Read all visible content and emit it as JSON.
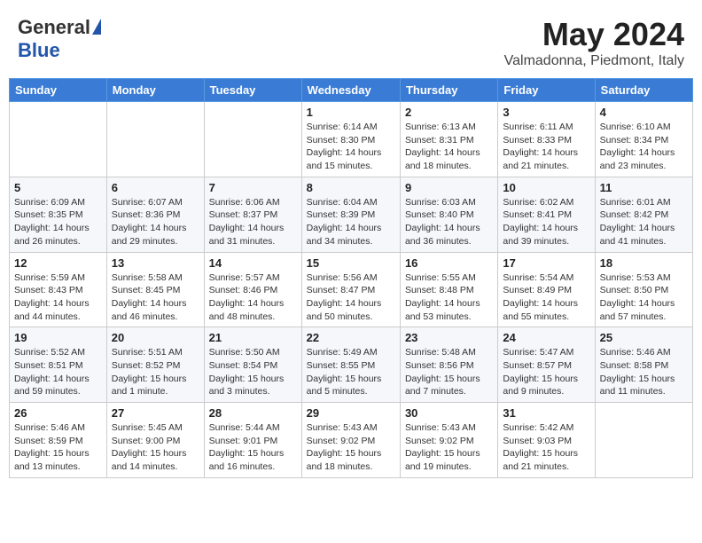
{
  "header": {
    "logo_general": "General",
    "logo_blue": "Blue",
    "main_title": "May 2024",
    "sub_title": "Valmadonna, Piedmont, Italy"
  },
  "days_of_week": [
    "Sunday",
    "Monday",
    "Tuesday",
    "Wednesday",
    "Thursday",
    "Friday",
    "Saturday"
  ],
  "weeks": [
    [
      {
        "day": "",
        "info": ""
      },
      {
        "day": "",
        "info": ""
      },
      {
        "day": "",
        "info": ""
      },
      {
        "day": "1",
        "info": "Sunrise: 6:14 AM\nSunset: 8:30 PM\nDaylight: 14 hours\nand 15 minutes."
      },
      {
        "day": "2",
        "info": "Sunrise: 6:13 AM\nSunset: 8:31 PM\nDaylight: 14 hours\nand 18 minutes."
      },
      {
        "day": "3",
        "info": "Sunrise: 6:11 AM\nSunset: 8:33 PM\nDaylight: 14 hours\nand 21 minutes."
      },
      {
        "day": "4",
        "info": "Sunrise: 6:10 AM\nSunset: 8:34 PM\nDaylight: 14 hours\nand 23 minutes."
      }
    ],
    [
      {
        "day": "5",
        "info": "Sunrise: 6:09 AM\nSunset: 8:35 PM\nDaylight: 14 hours\nand 26 minutes."
      },
      {
        "day": "6",
        "info": "Sunrise: 6:07 AM\nSunset: 8:36 PM\nDaylight: 14 hours\nand 29 minutes."
      },
      {
        "day": "7",
        "info": "Sunrise: 6:06 AM\nSunset: 8:37 PM\nDaylight: 14 hours\nand 31 minutes."
      },
      {
        "day": "8",
        "info": "Sunrise: 6:04 AM\nSunset: 8:39 PM\nDaylight: 14 hours\nand 34 minutes."
      },
      {
        "day": "9",
        "info": "Sunrise: 6:03 AM\nSunset: 8:40 PM\nDaylight: 14 hours\nand 36 minutes."
      },
      {
        "day": "10",
        "info": "Sunrise: 6:02 AM\nSunset: 8:41 PM\nDaylight: 14 hours\nand 39 minutes."
      },
      {
        "day": "11",
        "info": "Sunrise: 6:01 AM\nSunset: 8:42 PM\nDaylight: 14 hours\nand 41 minutes."
      }
    ],
    [
      {
        "day": "12",
        "info": "Sunrise: 5:59 AM\nSunset: 8:43 PM\nDaylight: 14 hours\nand 44 minutes."
      },
      {
        "day": "13",
        "info": "Sunrise: 5:58 AM\nSunset: 8:45 PM\nDaylight: 14 hours\nand 46 minutes."
      },
      {
        "day": "14",
        "info": "Sunrise: 5:57 AM\nSunset: 8:46 PM\nDaylight: 14 hours\nand 48 minutes."
      },
      {
        "day": "15",
        "info": "Sunrise: 5:56 AM\nSunset: 8:47 PM\nDaylight: 14 hours\nand 50 minutes."
      },
      {
        "day": "16",
        "info": "Sunrise: 5:55 AM\nSunset: 8:48 PM\nDaylight: 14 hours\nand 53 minutes."
      },
      {
        "day": "17",
        "info": "Sunrise: 5:54 AM\nSunset: 8:49 PM\nDaylight: 14 hours\nand 55 minutes."
      },
      {
        "day": "18",
        "info": "Sunrise: 5:53 AM\nSunset: 8:50 PM\nDaylight: 14 hours\nand 57 minutes."
      }
    ],
    [
      {
        "day": "19",
        "info": "Sunrise: 5:52 AM\nSunset: 8:51 PM\nDaylight: 14 hours\nand 59 minutes."
      },
      {
        "day": "20",
        "info": "Sunrise: 5:51 AM\nSunset: 8:52 PM\nDaylight: 15 hours\nand 1 minute."
      },
      {
        "day": "21",
        "info": "Sunrise: 5:50 AM\nSunset: 8:54 PM\nDaylight: 15 hours\nand 3 minutes."
      },
      {
        "day": "22",
        "info": "Sunrise: 5:49 AM\nSunset: 8:55 PM\nDaylight: 15 hours\nand 5 minutes."
      },
      {
        "day": "23",
        "info": "Sunrise: 5:48 AM\nSunset: 8:56 PM\nDaylight: 15 hours\nand 7 minutes."
      },
      {
        "day": "24",
        "info": "Sunrise: 5:47 AM\nSunset: 8:57 PM\nDaylight: 15 hours\nand 9 minutes."
      },
      {
        "day": "25",
        "info": "Sunrise: 5:46 AM\nSunset: 8:58 PM\nDaylight: 15 hours\nand 11 minutes."
      }
    ],
    [
      {
        "day": "26",
        "info": "Sunrise: 5:46 AM\nSunset: 8:59 PM\nDaylight: 15 hours\nand 13 minutes."
      },
      {
        "day": "27",
        "info": "Sunrise: 5:45 AM\nSunset: 9:00 PM\nDaylight: 15 hours\nand 14 minutes."
      },
      {
        "day": "28",
        "info": "Sunrise: 5:44 AM\nSunset: 9:01 PM\nDaylight: 15 hours\nand 16 minutes."
      },
      {
        "day": "29",
        "info": "Sunrise: 5:43 AM\nSunset: 9:02 PM\nDaylight: 15 hours\nand 18 minutes."
      },
      {
        "day": "30",
        "info": "Sunrise: 5:43 AM\nSunset: 9:02 PM\nDaylight: 15 hours\nand 19 minutes."
      },
      {
        "day": "31",
        "info": "Sunrise: 5:42 AM\nSunset: 9:03 PM\nDaylight: 15 hours\nand 21 minutes."
      },
      {
        "day": "",
        "info": ""
      }
    ]
  ]
}
